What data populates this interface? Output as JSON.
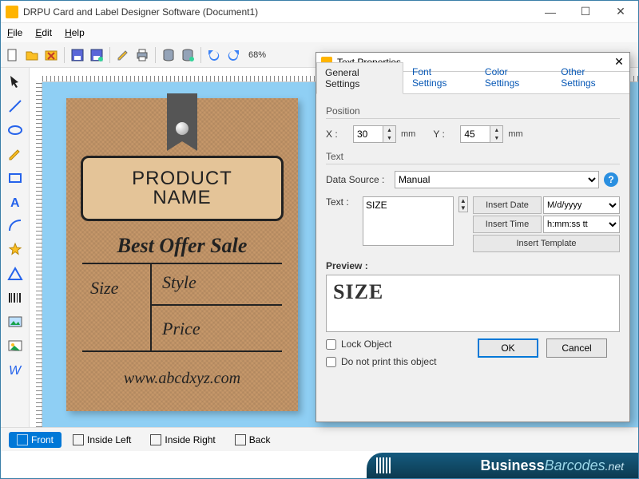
{
  "title": "DRPU Card and Label Designer Software (Document1)",
  "menus": {
    "file": "File",
    "edit": "Edit",
    "help": "Help"
  },
  "zoom": "68%",
  "card": {
    "product_l1": "PRODUCT",
    "product_l2": "NAME",
    "offer": "Best Offer Sale",
    "size": "Size",
    "style": "Style",
    "price": "Price",
    "url": "www.abcdxyz.com"
  },
  "page_tabs": {
    "front": "Front",
    "inside_left": "Inside Left",
    "inside_right": "Inside Right",
    "back": "Back"
  },
  "dialog": {
    "title": "Text Properties",
    "tabs": {
      "general": "General Settings",
      "font": "Font Settings",
      "color": "Color Settings",
      "other": "Other Settings"
    },
    "position": {
      "label": "Position",
      "x_label": "X :",
      "x_value": "30",
      "x_unit": "mm",
      "y_label": "Y :",
      "y_value": "45",
      "y_unit": "mm"
    },
    "text_group": "Text",
    "datasource_label": "Data Source :",
    "datasource_value": "Manual",
    "text_label": "Text :",
    "text_value": "SIZE",
    "insert_date": "Insert Date",
    "date_format": "M/d/yyyy",
    "insert_time": "Insert Time",
    "time_format": "h:mm:ss tt",
    "insert_template": "Insert Template",
    "preview_label": "Preview :",
    "preview_value": "SIZE",
    "lock": "Lock Object",
    "noprint": "Do not print this object",
    "ok": "OK",
    "cancel": "Cancel"
  },
  "brand": {
    "b1": "Business",
    "b2": "Barcodes",
    "net": ".net"
  }
}
